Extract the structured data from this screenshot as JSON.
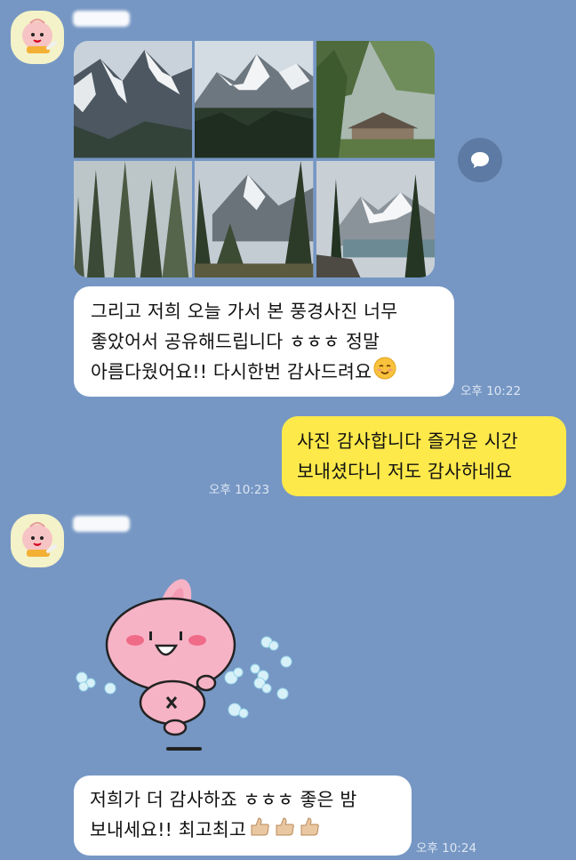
{
  "messages": [
    {
      "id": "m1",
      "sender": "received",
      "sender_name": "",
      "photos": [
        {
          "scene": "snowy-mountain-peaks"
        },
        {
          "scene": "mountain-range-forest"
        },
        {
          "scene": "forest-lodge"
        },
        {
          "scene": "pine-trees"
        },
        {
          "scene": "forest-valley"
        },
        {
          "scene": "glacier-lake"
        }
      ]
    },
    {
      "id": "m2",
      "sender": "received",
      "lines": [
        "그리고 저희 오늘 가서 본 풍경사진 너무",
        "좋았어서 공유해드립니다 ㅎㅎㅎ 정말",
        "아름다웠어요!! 다시한번 감사드려요"
      ],
      "emoji": "smiling-face-emoji",
      "time": "오후 10:22"
    },
    {
      "id": "m3",
      "sender": "sent",
      "lines": [
        "사진 감사합니다 즐거운 시간",
        "보내셨다니 저도 감사하네요"
      ],
      "time": "오후 10:23"
    },
    {
      "id": "m4",
      "sender": "received",
      "sender_name": "",
      "sticker": "pink-bunny-sticker"
    },
    {
      "id": "m5",
      "sender": "received",
      "lines": [
        "저희가 더 감사하죠 ㅎㅎㅎ 좋은 밤",
        "보내세요!! 최고최고"
      ],
      "emoji": "thumbs-up-emoji",
      "time": "오후 10:24"
    }
  ],
  "colors": {
    "background": "#7697c4",
    "received_bubble": "#ffffff",
    "sent_bubble": "#fee94b",
    "timestamp": "#dde6f3"
  },
  "icons": [
    "share-icon",
    "avatar-peach-character"
  ]
}
